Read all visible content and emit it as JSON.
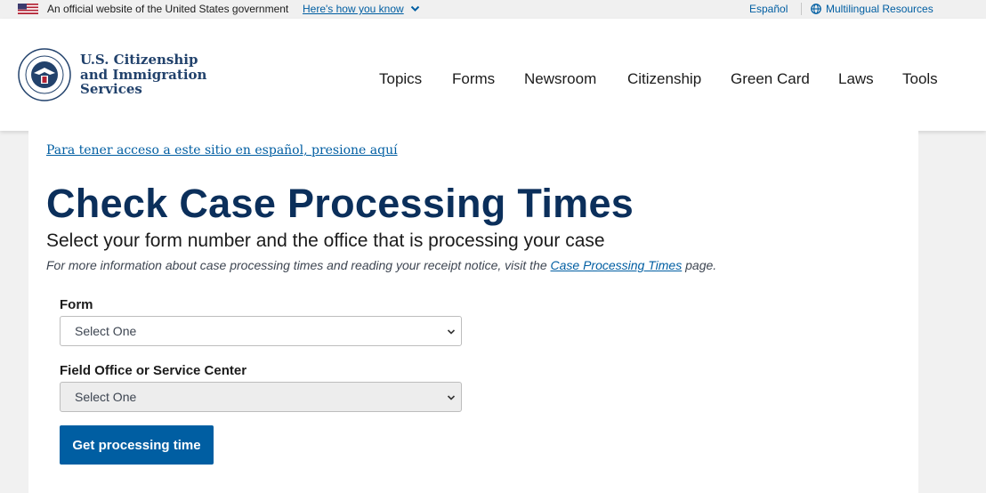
{
  "banner": {
    "official": "An official website of the United States government",
    "how_you_know": "Here's how you know",
    "espanol": "Español",
    "multilingual": "Multilingual Resources"
  },
  "header": {
    "agency_line1": "U.S. Citizenship",
    "agency_line2": "and Immigration",
    "agency_line3": "Services",
    "nav": [
      "Topics",
      "Forms",
      "Newsroom",
      "Citizenship",
      "Green Card",
      "Laws",
      "Tools"
    ]
  },
  "main": {
    "spanish_link": "Para tener acceso a este sitio en español, presione aquí",
    "title": "Check Case Processing Times",
    "subtitle": "Select your form number and the office that is processing your case",
    "info_prefix": "For more information about case processing times and reading your receipt notice, visit the",
    "info_link": "Case Processing Times",
    "info_suffix": "page.",
    "form_label": "Form",
    "form_value": "Select One",
    "office_label": "Field Office or Service Center",
    "office_value": "Select One",
    "submit": "Get processing time"
  },
  "colors": {
    "link": "#005ea2",
    "title": "#0b2f5b",
    "agency": "#22426c",
    "button": "#005ea2"
  }
}
